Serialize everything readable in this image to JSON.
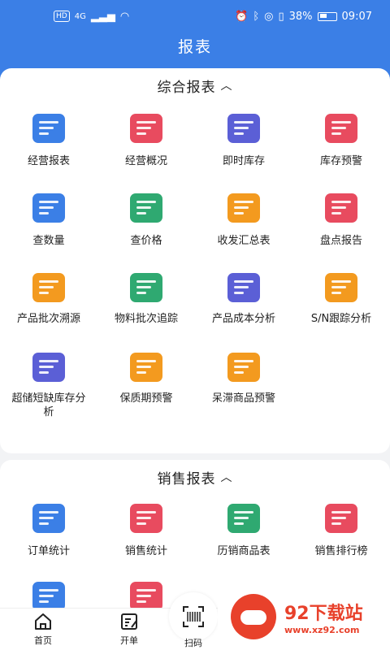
{
  "statusbar": {
    "hd": "HD",
    "net": "4G",
    "battery": "38%",
    "time": "09:07"
  },
  "header": {
    "title": "报表"
  },
  "section1": {
    "title": "综合报表",
    "items": [
      {
        "label": "经营报表",
        "color": "#3b7fe6",
        "icon": "storefront-icon"
      },
      {
        "label": "经营概况",
        "color": "#e84b5f",
        "icon": "store-trend-icon"
      },
      {
        "label": "即时库存",
        "color": "#5b5fd6",
        "icon": "warehouse-boxes-icon"
      },
      {
        "label": "库存预警",
        "color": "#e84b5f",
        "icon": "warehouse-alert-icon"
      },
      {
        "label": "查数量",
        "color": "#3b7fe6",
        "icon": "grid-search-icon"
      },
      {
        "label": "查价格",
        "color": "#2fa971",
        "icon": "coins-search-icon"
      },
      {
        "label": "收发汇总表",
        "color": "#f39a1f",
        "icon": "transfer-icon"
      },
      {
        "label": "盘点报告",
        "color": "#e84b5f",
        "icon": "house-edit-icon"
      },
      {
        "label": "产品批次溯源",
        "color": "#f39a1f",
        "icon": "batch-trace-icon"
      },
      {
        "label": "物料批次追踪",
        "color": "#2fa971",
        "icon": "material-trace-icon"
      },
      {
        "label": "产品成本分析",
        "color": "#5b5fd6",
        "icon": "cost-analysis-icon"
      },
      {
        "label": "S/N跟踪分析",
        "color": "#f39a1f",
        "icon": "sn-tracking-icon"
      },
      {
        "label": "超储短缺库存分析",
        "color": "#5b5fd6",
        "icon": "pie-house-icon"
      },
      {
        "label": "保质期预警",
        "color": "#f39a1f",
        "icon": "clock-alert-icon"
      },
      {
        "label": "呆滞商品预警",
        "color": "#f39a1f",
        "icon": "face-alert-icon"
      }
    ]
  },
  "section2": {
    "title": "销售报表",
    "items": [
      {
        "label": "订单统计",
        "color": "#3b7fe6",
        "icon": "clipboard-chart-icon"
      },
      {
        "label": "销售统计",
        "color": "#e84b5f",
        "icon": "clipboard-bars-icon"
      },
      {
        "label": "历销商品表",
        "color": "#2fa971",
        "icon": "boxes-clock-icon"
      },
      {
        "label": "销售排行榜",
        "color": "#e84b5f",
        "icon": "trophy-icon"
      },
      {
        "label": "",
        "color": "#3b7fe6",
        "icon": "money-bag-icon"
      },
      {
        "label": "",
        "color": "#e84b5f",
        "icon": "clipboard-report-icon"
      }
    ]
  },
  "bottom_nav": {
    "home": "首页",
    "order": "开单",
    "scan": "扫码"
  },
  "watermark": {
    "name": "92下载站",
    "url": "www.xz92.com"
  }
}
